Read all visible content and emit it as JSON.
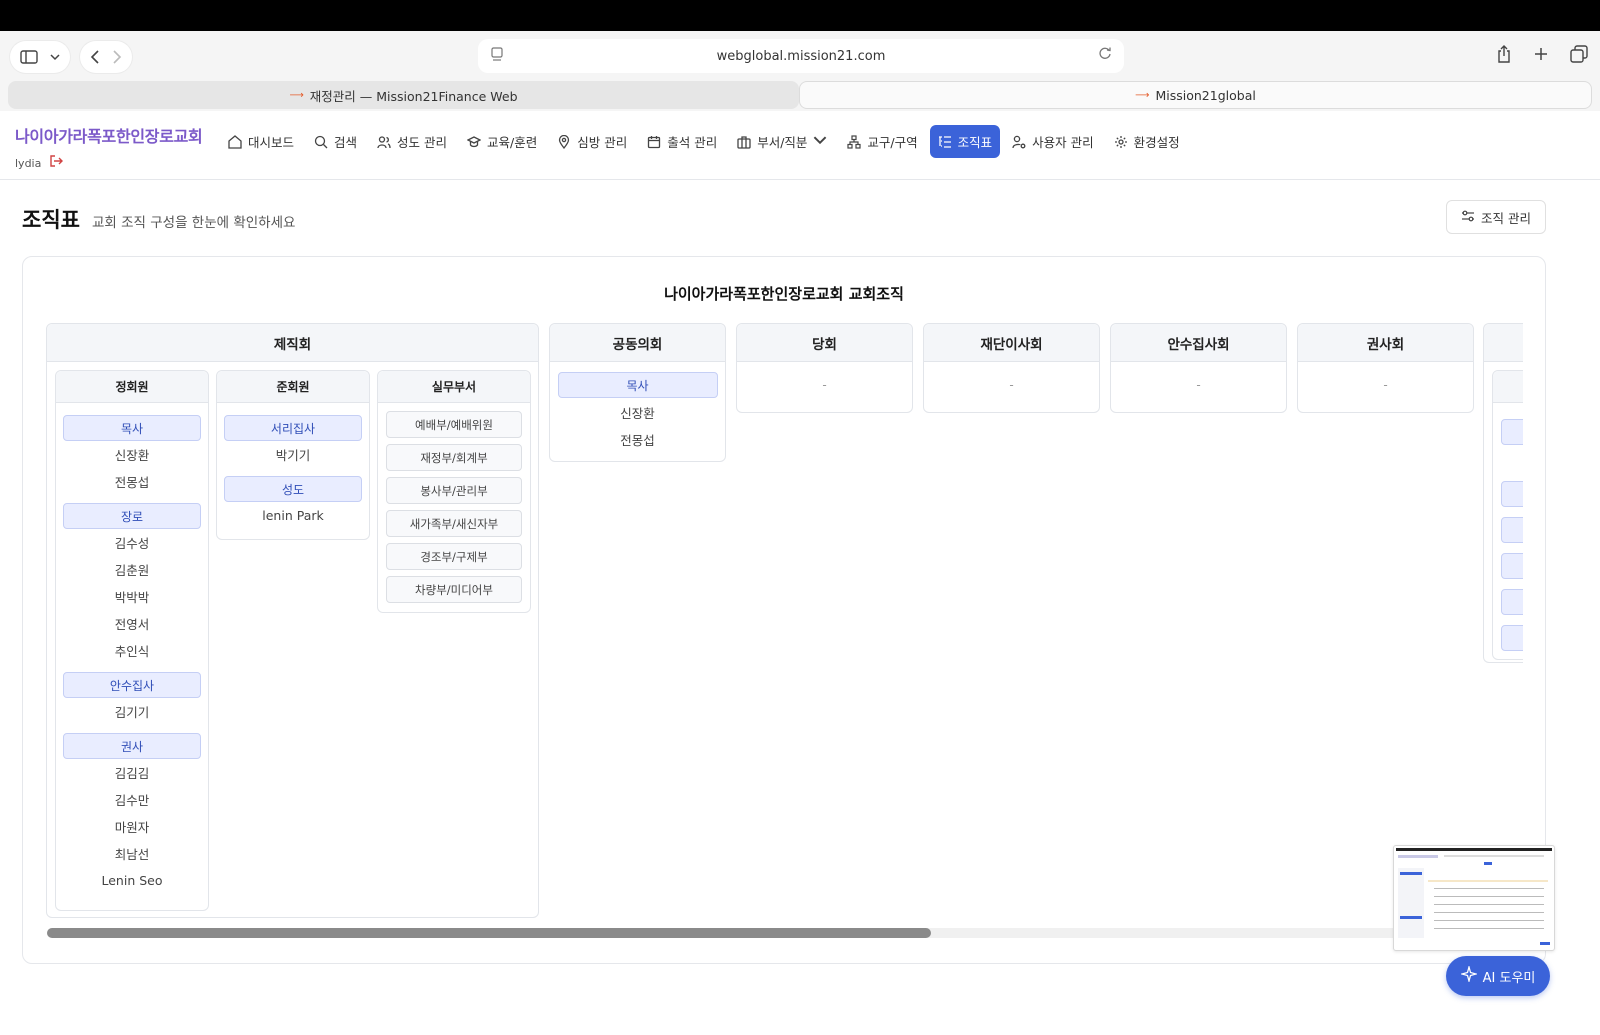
{
  "browser": {
    "url": "webglobal.mission21.com",
    "tabs": [
      {
        "label": "재정관리 — Mission21Finance Web"
      },
      {
        "label": "Mission21global"
      }
    ]
  },
  "header": {
    "church_name": "나이아가라폭포한인장로교회",
    "user": "lydia",
    "nav": [
      {
        "label": "대시보드",
        "icon": "home-icon"
      },
      {
        "label": "검색",
        "icon": "search-icon"
      },
      {
        "label": "성도 관리",
        "icon": "users-icon"
      },
      {
        "label": "교육/훈련",
        "icon": "graduation-cap-icon"
      },
      {
        "label": "심방 관리",
        "icon": "map-pin-icon"
      },
      {
        "label": "출석 관리",
        "icon": "calendar-icon"
      },
      {
        "label": "부서/직분",
        "icon": "briefcase-icon"
      },
      {
        "label": "교구/구역",
        "icon": "network-icon"
      },
      {
        "label": "조직표",
        "icon": "list-tree-icon",
        "active": true
      },
      {
        "label": "사용자 관리",
        "icon": "user-cog-icon"
      },
      {
        "label": "환경설정",
        "icon": "gear-icon"
      }
    ]
  },
  "page": {
    "title": "조직표",
    "subtitle": "교회 조직 구성을 한눈에 확인하세요",
    "manage_button": "조직 관리",
    "org_title": "나이아가라폭포한인장로교회 교회조직"
  },
  "org": {
    "jejikhoe": {
      "name": "제직회",
      "members_regular": {
        "name": "정회원",
        "roles": [
          {
            "role": "목사",
            "people": [
              "신장환",
              "전몽섭"
            ]
          },
          {
            "role": "장로",
            "people": [
              "김수성",
              "김춘원",
              "박박박",
              "전영서",
              "추인식"
            ]
          },
          {
            "role": "안수집사",
            "people": [
              "김기기"
            ]
          },
          {
            "role": "권사",
            "people": [
              "김김김",
              "김수만",
              "마원자",
              "최남선",
              "Lenin Seo"
            ]
          }
        ]
      },
      "members_associate": {
        "name": "준회원",
        "roles": [
          {
            "role": "서리집사",
            "people": [
              "박기기"
            ]
          },
          {
            "role": "성도",
            "people": [
              "lenin Park"
            ]
          }
        ]
      },
      "departments": {
        "name": "실무부서",
        "items": [
          "예배부/예배위원",
          "재정부/회계부",
          "봉사부/관리부",
          "새가족부/새신자부",
          "경조부/구제부",
          "차량부/미디어부"
        ]
      }
    },
    "joint_council": {
      "name": "공동의회",
      "role": "목사",
      "people": [
        "신장환",
        "전몽섭"
      ]
    },
    "empty_groups": [
      {
        "name": "당회",
        "placeholder": "-"
      },
      {
        "name": "재단이사회",
        "placeholder": "-"
      },
      {
        "name": "안수집사회",
        "placeholder": "-"
      },
      {
        "name": "권사회",
        "placeholder": "-"
      }
    ]
  },
  "ai_button": "AI 도우미",
  "colors": {
    "accent": "#3b63d9",
    "brand": "#7c5ac9",
    "role_tag_bg": "#e9edff"
  }
}
